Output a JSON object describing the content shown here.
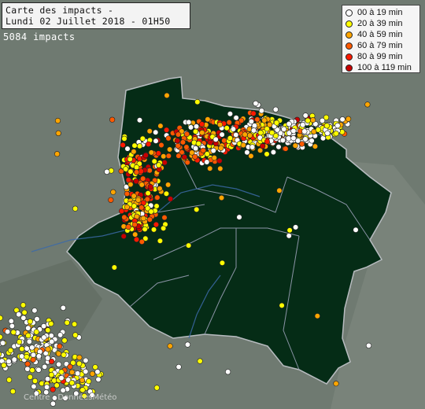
{
  "header": {
    "title_line1": "Carte des impacts -",
    "title_line2": "Lundi 02 Juillet 2018 - 01H50",
    "impact_count": "5084 impacts"
  },
  "legend": [
    {
      "label": "00 à 19 min",
      "color": "#ffffff"
    },
    {
      "label": "20 à 39 min",
      "color": "#ffff00"
    },
    {
      "label": "40 à 59 min",
      "color": "#ffa500"
    },
    {
      "label": "60 à 79 min",
      "color": "#ff5a00"
    },
    {
      "label": "80 à 99 min",
      "color": "#ff1a00"
    },
    {
      "label": "100 à 119 min",
      "color": "#c80000"
    }
  ],
  "footer": {
    "credit": "Centre - DonnéesMétéo"
  }
}
